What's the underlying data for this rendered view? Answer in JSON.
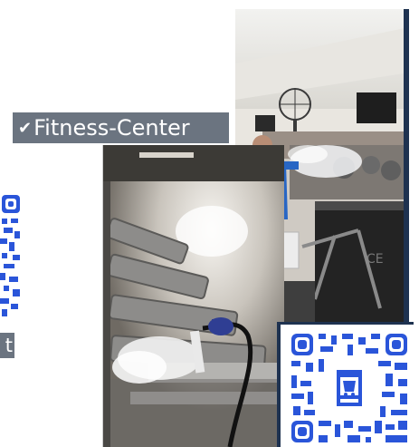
{
  "tag": {
    "check": "✔",
    "text": "Fitness-Center"
  },
  "left_label": {
    "text": "t"
  },
  "photos": {
    "top": {
      "subject": "person-spraying-disinfectant-near-turnstile"
    },
    "bottom": {
      "subject": "treadmills-with-steam-disinfection"
    }
  },
  "qr": {
    "accent": "#2a55d9"
  },
  "colors": {
    "tag_bg": "#6b7480",
    "card_border": "#1e3250"
  }
}
